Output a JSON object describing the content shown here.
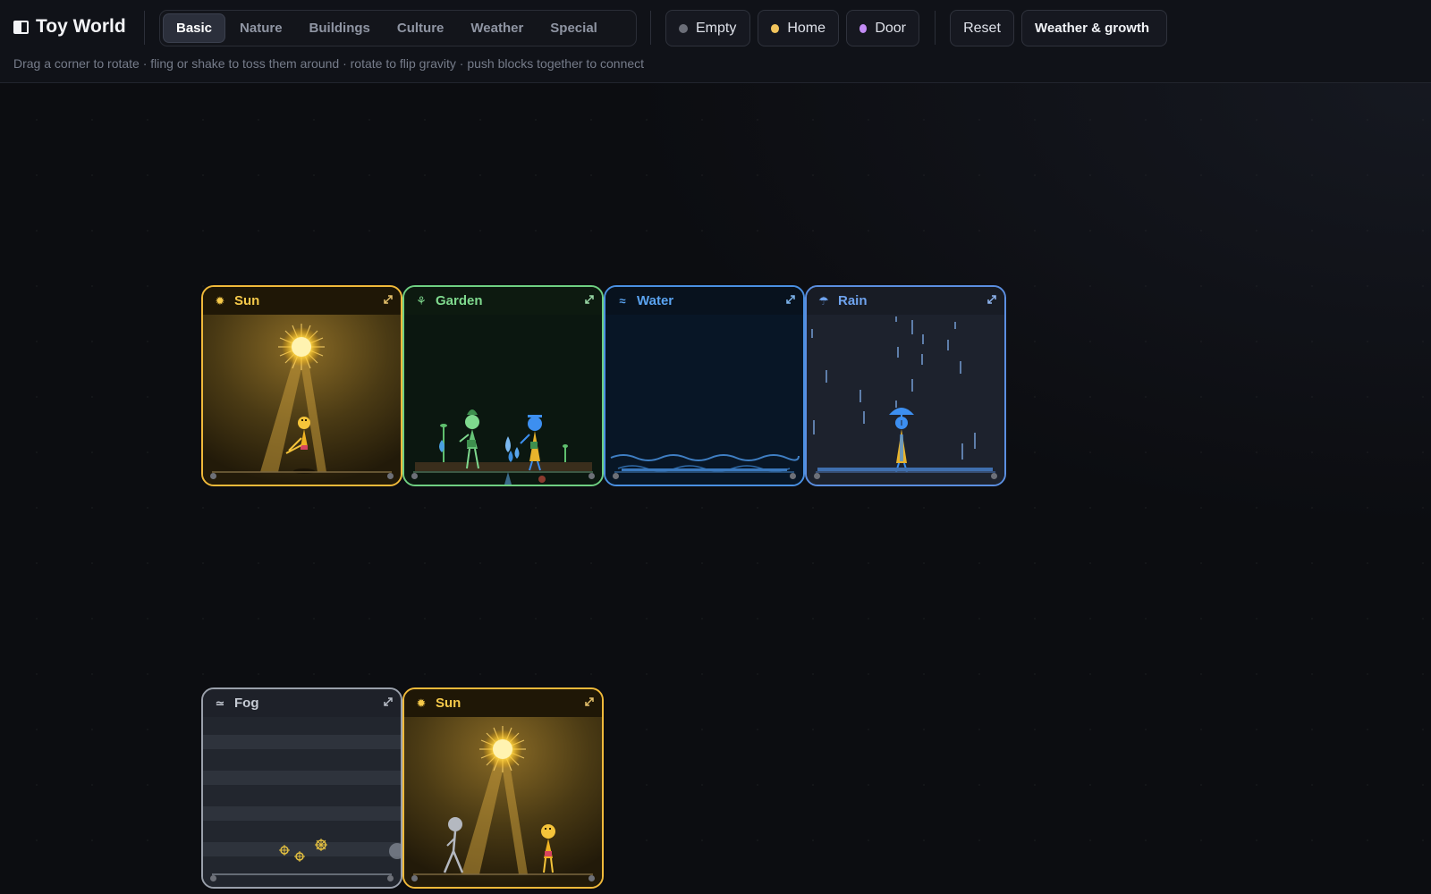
{
  "app": {
    "title": "Toy World"
  },
  "tabs": [
    {
      "label": "Basic",
      "active": true
    },
    {
      "label": "Nature"
    },
    {
      "label": "Buildings"
    },
    {
      "label": "Culture"
    },
    {
      "label": "Weather"
    },
    {
      "label": "Special"
    }
  ],
  "modes": {
    "empty": {
      "label": "Empty",
      "color": "#6b6e78"
    },
    "home": {
      "label": "Home",
      "color": "#f2c45c"
    },
    "door": {
      "label": "Door",
      "color": "#c38cf5"
    }
  },
  "actions": {
    "reset": "Reset",
    "weather_toggle": "Weather & growth"
  },
  "hint": "Drag a corner to rotate · fling or shake to toss them around · rotate to flip gravity · push blocks together to connect",
  "blocks": {
    "sun_1": {
      "title": "Sun",
      "icon": "sun-icon",
      "color": "#f0b93a"
    },
    "garden": {
      "title": "Garden",
      "icon": "sprout-icon",
      "color": "#6fcf82"
    },
    "water": {
      "title": "Water",
      "icon": "waves-icon",
      "color": "#4a90e2"
    },
    "rain": {
      "title": "Rain",
      "icon": "rain-cloud-icon",
      "color": "#5b8ee0"
    },
    "fog": {
      "title": "Fog",
      "icon": "fog-icon",
      "color": "#9aa0ab"
    },
    "sun_2": {
      "title": "Sun",
      "icon": "sun-icon",
      "color": "#f0b93a"
    }
  }
}
